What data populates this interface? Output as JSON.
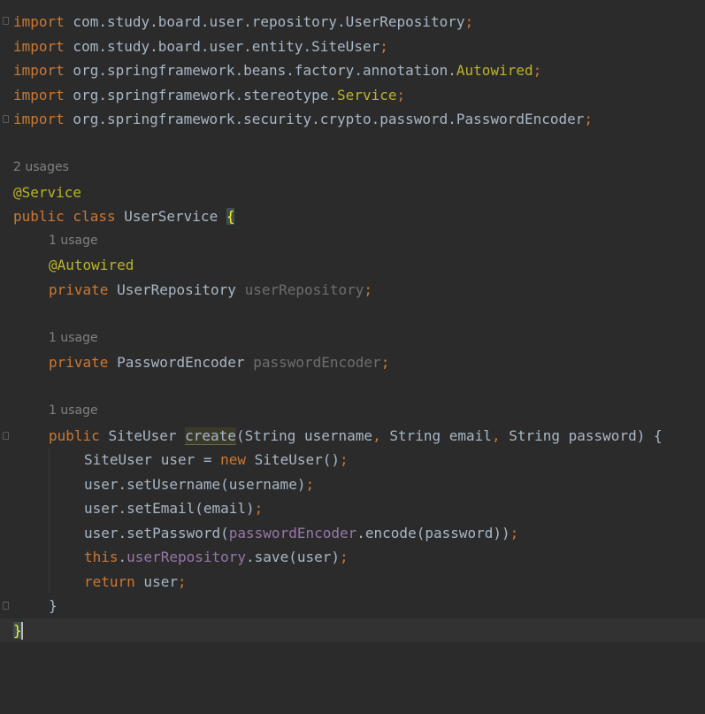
{
  "editor": {
    "imports": [
      {
        "kw": "import",
        "path": " com.study.board.user.repository.UserRepository",
        "semi": ";"
      },
      {
        "kw": "import",
        "path": " com.study.board.user.entity.SiteUser",
        "semi": ";"
      },
      {
        "kw": "import",
        "path": " org.springframework.beans.factory.annotation.",
        "ann": "Autowired",
        "semi": ";"
      },
      {
        "kw": "import",
        "path": " org.springframework.stereotype.",
        "ann": "Service",
        "semi": ";"
      },
      {
        "kw": "import",
        "path": " org.springframework.security.crypto.password.PasswordEncoder",
        "semi": ";"
      }
    ],
    "hints": {
      "class_usages": "2 usages",
      "repo_usage": "1 usage",
      "encoder_usage": "1 usage",
      "create_usage": "1 usage"
    },
    "class_decl": {
      "annotation": "@Service",
      "mods": "public class ",
      "name": "UserService ",
      "open": "{",
      "close": "}"
    },
    "field_repo": {
      "annotation": "@Autowired",
      "mod": "private ",
      "type": "UserRepository ",
      "name": "userRepository",
      "semi": ";"
    },
    "field_encoder": {
      "mod": "private ",
      "type": "PasswordEncoder ",
      "name": "passwordEncoder",
      "semi": ";"
    },
    "method": {
      "mod": "public ",
      "ret": "SiteUser ",
      "name": "create",
      "p_open": "(String username",
      "comma1": ",",
      "p2": " String email",
      "comma2": ",",
      "p3": " String password) {",
      "close": "}"
    },
    "body": {
      "l1_a": "SiteUser user = ",
      "l1_new": "new",
      "l1_b": " SiteUser()",
      "l1_semi": ";",
      "l2": "user.setUsername(username)",
      "l2_semi": ";",
      "l3": "user.setEmail(email)",
      "l3_semi": ";",
      "l4_a": "user.setPassword(",
      "l4_field": "passwordEncoder",
      "l4_b": ".encode(password))",
      "l4_semi": ";",
      "l5_this": "this",
      "l5_dot": ".",
      "l5_field": "userRepository",
      "l5_b": ".save(user)",
      "l5_semi": ";",
      "l6_ret": "return",
      "l6_b": " user",
      "l6_semi": ";"
    }
  }
}
